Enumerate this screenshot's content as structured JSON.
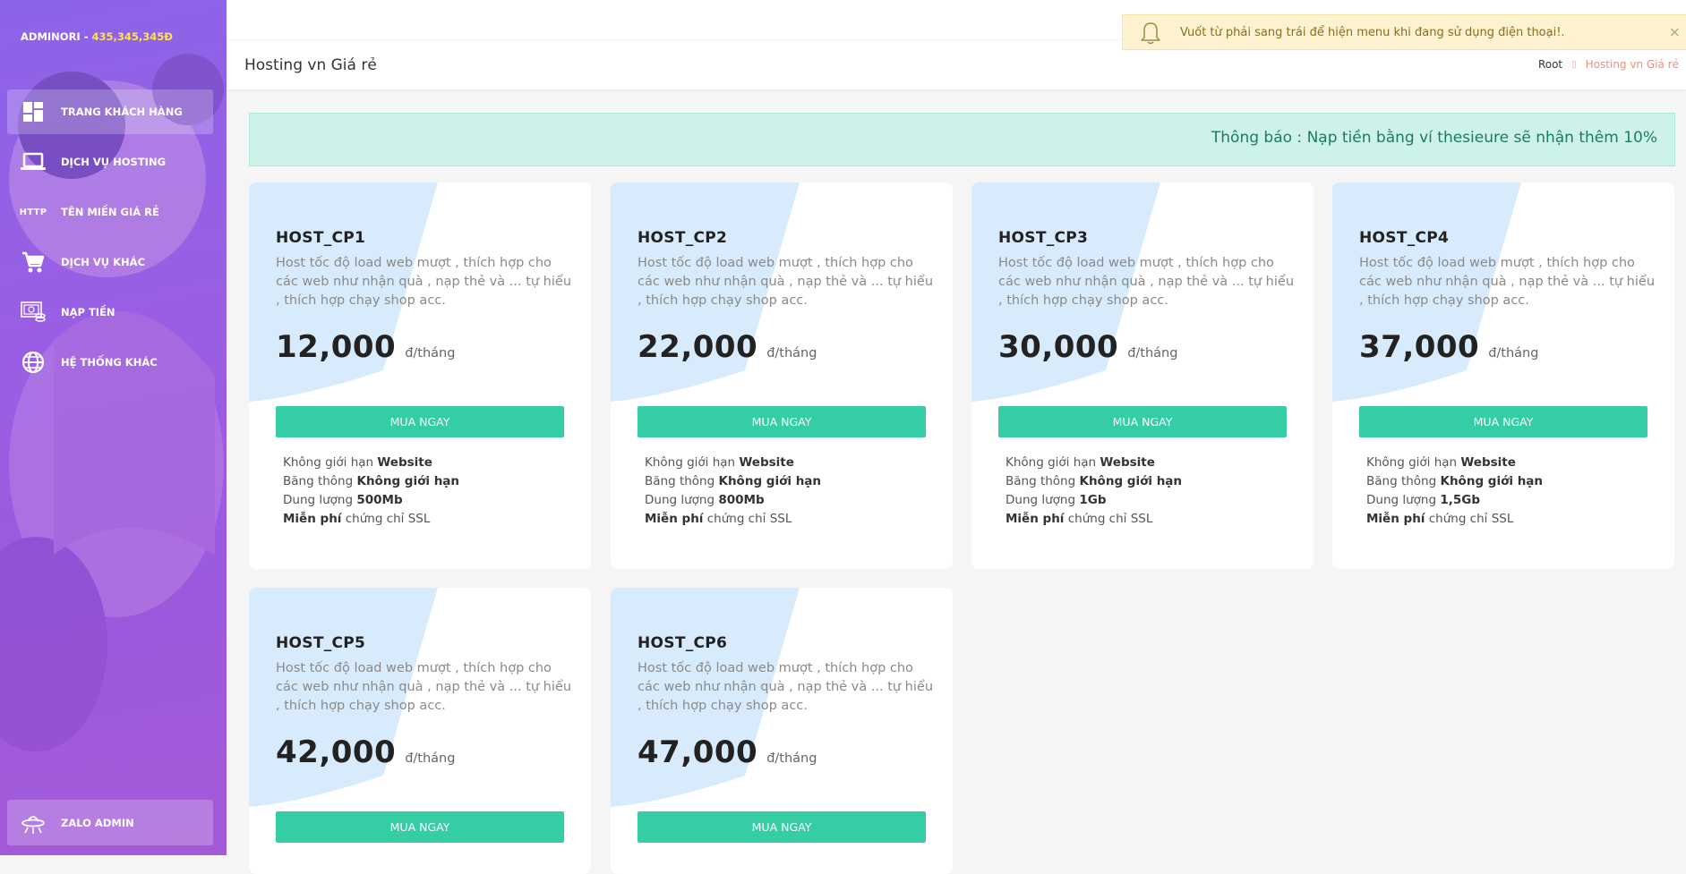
{
  "user": {
    "name_prefix": "ADMINORI - ",
    "balance": "435,345,345Đ"
  },
  "sidebar": {
    "items": [
      {
        "label": "TRANG KHÁCH HÀNG",
        "icon": "dashboard-icon"
      },
      {
        "label": "DỊCH VỤ HOSTING",
        "icon": "laptop-icon"
      },
      {
        "label": "TÊN MIỀN GIÁ RẺ",
        "icon": "http-icon",
        "icon_text": "HTTP"
      },
      {
        "label": "DỊCH VỤ KHÁC",
        "icon": "cart-icon"
      },
      {
        "label": "NẠP TIỀN",
        "icon": "money-icon"
      },
      {
        "label": "HỆ THỐNG KHÁC",
        "icon": "globe-icon"
      }
    ],
    "bottom": {
      "label": "ZALO ADMIN",
      "icon": "ufo-icon"
    }
  },
  "header": {
    "title": "Hosting vn Giá rẻ",
    "breadcrumb": {
      "root": "Root",
      "current": "Hosting vn Giá rẻ"
    }
  },
  "toast": {
    "message": "Vuốt từ phải sang trái để hiện menu khi đang sử dụng điện thoại!."
  },
  "notice": {
    "text": "Thông báo : Nạp tiền bằng ví thesieure sẽ nhận thêm 10%"
  },
  "plans": [
    {
      "name": "HOST_CP1",
      "desc": "Host tốc độ load web mượt , thích hợp cho các web như nhận quà , nạp thẻ và ... tự hiểu , thích hợp chạy shop acc.",
      "price": "12,000",
      "unit": "đ/tháng",
      "button": "MUA NGAY",
      "features": {
        "f1_text": "Không giới hạn ",
        "f1_bold": "Website",
        "f2_text": "Băng thông ",
        "f2_bold": "Không giới hạn",
        "f3_text": "Dung lượng ",
        "f3_bold": "500Mb",
        "f4_bold": "Miễn phí",
        "f4_text": " chứng chỉ SSL"
      }
    },
    {
      "name": "HOST_CP2",
      "desc": "Host tốc độ load web mượt , thích hợp cho các web như nhận quà , nạp thẻ và ... tự hiểu , thích hợp chạy shop acc.",
      "price": "22,000",
      "unit": "đ/tháng",
      "button": "MUA NGAY",
      "features": {
        "f1_text": "Không giới hạn ",
        "f1_bold": "Website",
        "f2_text": "Băng thông ",
        "f2_bold": "Không giới hạn",
        "f3_text": "Dung lượng ",
        "f3_bold": "800Mb",
        "f4_bold": "Miễn phí",
        "f4_text": " chứng chỉ SSL"
      }
    },
    {
      "name": "HOST_CP3",
      "desc": "Host tốc độ load web mượt , thích hợp cho các web như nhận quà , nạp thẻ và ... tự hiểu , thích hợp chạy shop acc.",
      "price": "30,000",
      "unit": "đ/tháng",
      "button": "MUA NGAY",
      "features": {
        "f1_text": "Không giới hạn ",
        "f1_bold": "Website",
        "f2_text": "Băng thông ",
        "f2_bold": "Không giới hạn",
        "f3_text": "Dung lượng ",
        "f3_bold": "1Gb",
        "f4_bold": "Miễn phí",
        "f4_text": " chứng chỉ SSL"
      }
    },
    {
      "name": "HOST_CP4",
      "desc": "Host tốc độ load web mượt , thích hợp cho các web như nhận quà , nạp thẻ và ... tự hiểu , thích hợp chạy shop acc.",
      "price": "37,000",
      "unit": "đ/tháng",
      "button": "MUA NGAY",
      "features": {
        "f1_text": "Không giới hạn ",
        "f1_bold": "Website",
        "f2_text": "Băng thông ",
        "f2_bold": "Không giới hạn",
        "f3_text": "Dung lượng ",
        "f3_bold": "1,5Gb",
        "f4_bold": "Miễn phí",
        "f4_text": " chứng chỉ SSL"
      }
    },
    {
      "name": "HOST_CP5",
      "desc": "Host tốc độ load web mượt , thích hợp cho các web như nhận quà , nạp thẻ và ... tự hiểu , thích hợp chạy shop acc.",
      "price": "42,000",
      "unit": "đ/tháng",
      "button": "MUA NGAY"
    },
    {
      "name": "HOST_CP6",
      "desc": "Host tốc độ load web mượt , thích hợp cho các web như nhận quà , nạp thẻ và ... tự hiểu , thích hợp chạy shop acc.",
      "price": "47,000",
      "unit": "đ/tháng",
      "button": "MUA NGAY"
    }
  ],
  "colors": {
    "accent": "#35cda6",
    "sidebar": "#9a5ee4",
    "notice_bg": "#ccf2e9",
    "toast_bg": "#fdf3d0"
  }
}
